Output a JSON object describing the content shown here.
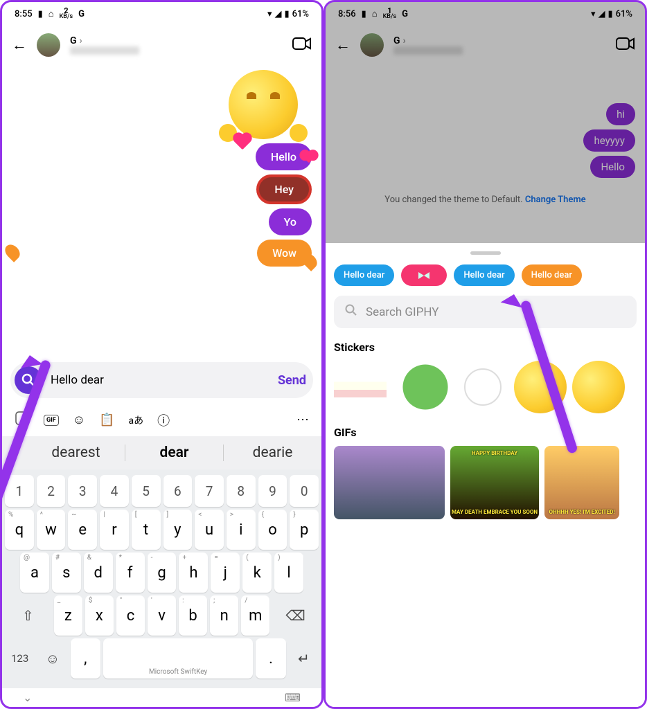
{
  "left": {
    "status": {
      "time": "8:55",
      "kbs": "2",
      "kbs_unit": "KB/s",
      "g": "G",
      "battery": "61%"
    },
    "header": {
      "name": "G",
      "chevron": "›"
    },
    "messages": [
      {
        "text": "Hello",
        "style": "purple"
      },
      {
        "text": "Hey",
        "style": "red"
      },
      {
        "text": "Yo",
        "style": "purple"
      },
      {
        "text": "Wow",
        "style": "orange"
      }
    ],
    "compose": {
      "value": "Hello dear",
      "send": "Send"
    },
    "kb_top_icons": [
      "copilot",
      "gif",
      "sticker",
      "clipboard",
      "translate",
      "info",
      "more"
    ],
    "suggestions": {
      "left": "dearest",
      "mid": "dear",
      "right": "dearie"
    },
    "num_row": [
      "1",
      "2",
      "3",
      "4",
      "5",
      "6",
      "7",
      "8",
      "9",
      "0"
    ],
    "row1": [
      {
        "k": "q",
        "h": "%"
      },
      {
        "k": "w",
        "h": "^"
      },
      {
        "k": "e",
        "h": "~"
      },
      {
        "k": "r",
        "h": "|"
      },
      {
        "k": "t",
        "h": "["
      },
      {
        "k": "y",
        "h": "]"
      },
      {
        "k": "u",
        "h": "<"
      },
      {
        "k": "i",
        "h": ">"
      },
      {
        "k": "o",
        "h": "{"
      },
      {
        "k": "p",
        "h": "}"
      }
    ],
    "row2": [
      {
        "k": "a",
        "h": "@"
      },
      {
        "k": "s",
        "h": "#"
      },
      {
        "k": "d",
        "h": "&"
      },
      {
        "k": "f",
        "h": "*"
      },
      {
        "k": "g",
        "h": "-"
      },
      {
        "k": "h",
        "h": "+"
      },
      {
        "k": "j",
        "h": "="
      },
      {
        "k": "k",
        "h": "("
      },
      {
        "k": "l",
        "h": ")"
      }
    ],
    "row3": [
      {
        "k": "z",
        "h": "_"
      },
      {
        "k": "x",
        "h": "$"
      },
      {
        "k": "c",
        "h": "\""
      },
      {
        "k": "v",
        "h": "'"
      },
      {
        "k": "b",
        "h": ":"
      },
      {
        "k": "n",
        "h": ";"
      },
      {
        "k": "m",
        "h": "/"
      }
    ],
    "bottom": {
      "num": "123",
      "space": "Microsoft SwiftKey",
      "comma": ",",
      "period": "."
    }
  },
  "right": {
    "status": {
      "time": "8:56",
      "kbs": "1",
      "kbs_unit": "KB/s",
      "g": "G",
      "battery": "61%"
    },
    "header": {
      "name": "G",
      "chevron": "›"
    },
    "messages": [
      {
        "text": "hi"
      },
      {
        "text": "heyyyy"
      },
      {
        "text": "Hello"
      }
    ],
    "theme_msg": "You changed the theme to Default.",
    "theme_link": "Change Theme",
    "effects": [
      "Hello dear",
      "",
      "Hello dear",
      "Hello dear"
    ],
    "search_placeholder": "Search GIPHY",
    "section_stickers": "Stickers",
    "section_gifs": "GIFs",
    "gif2_top": "HAPPY BIRTHDAY",
    "gif2_bot": "MAY DEATH EMBRACE YOU SOON",
    "gif3_txt": "OHHHH YES! I'M EXCITED!"
  }
}
